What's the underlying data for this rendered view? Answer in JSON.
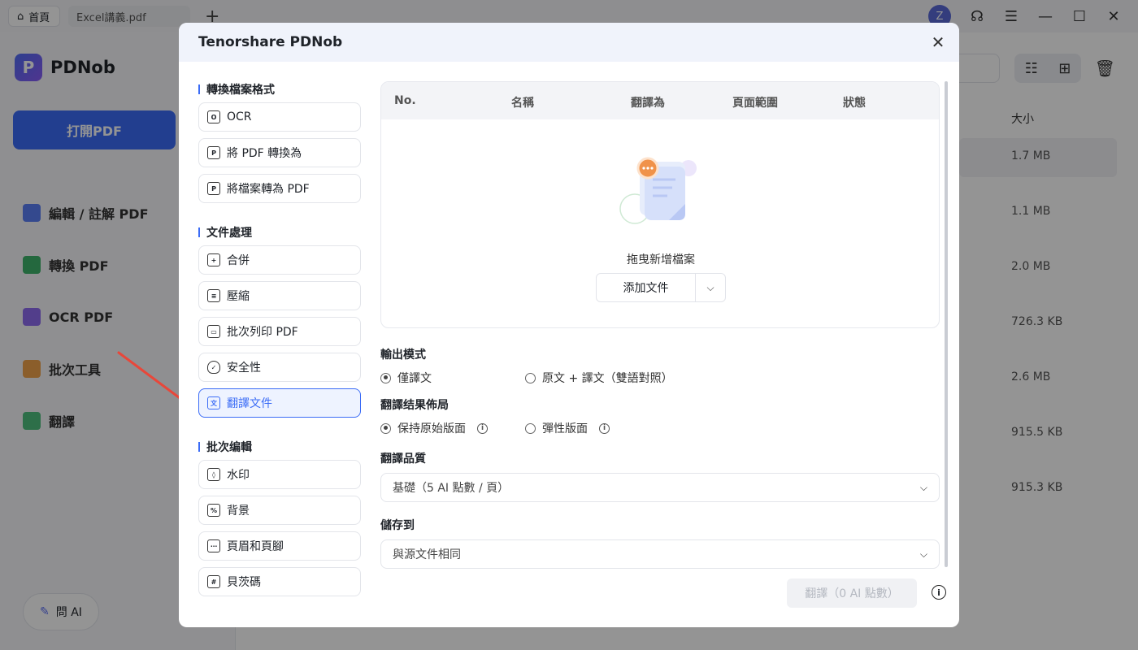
{
  "topbar": {
    "home_tab": "首頁",
    "file_tab": "Excel講義.pdf",
    "avatar_letter": "Z"
  },
  "sidebar": {
    "brand": "PDNob",
    "open_pdf": "打開PDF",
    "items": [
      {
        "label": "編輯 / 註解 PDF"
      },
      {
        "label": "轉換 PDF"
      },
      {
        "label": "OCR PDF"
      },
      {
        "label": "批次工具"
      },
      {
        "label": "翻譯"
      }
    ],
    "ask_ai": "問 AI"
  },
  "file_list": {
    "size_header": "大小",
    "sizes": [
      "1.7 MB",
      "1.1 MB",
      "2.0 MB",
      "726.3 KB",
      "2.6 MB",
      "915.5 KB",
      "915.3 KB"
    ]
  },
  "dialog": {
    "title": "Tenorshare PDNob",
    "sections": [
      {
        "title": "轉換檔案格式",
        "tools": [
          {
            "label": "OCR"
          },
          {
            "label": "將 PDF 轉換為"
          },
          {
            "label": "將檔案轉為 PDF"
          }
        ]
      },
      {
        "title": "文件處理",
        "tools": [
          {
            "label": "合併"
          },
          {
            "label": "壓縮"
          },
          {
            "label": "批次列印 PDF"
          },
          {
            "label": "安全性"
          },
          {
            "label": "翻譯文件"
          }
        ]
      },
      {
        "title": "批次编輯",
        "tools": [
          {
            "label": "水印"
          },
          {
            "label": "背景"
          },
          {
            "label": "頁眉和頁腳"
          },
          {
            "label": "貝茨碼"
          }
        ]
      }
    ],
    "table": {
      "columns": [
        "No.",
        "名稱",
        "翻譯為",
        "頁面範圍",
        "狀態"
      ],
      "empty_text": "拖曳新增檔案",
      "add_file": "添加文件"
    },
    "output_mode": {
      "label": "輸出模式",
      "options": [
        "僅譯文",
        "原文 + 譯文（雙語對照）"
      ],
      "selected": 0
    },
    "layout": {
      "label": "翻譯结果佈局",
      "options": [
        "保持原始版面",
        "彈性版面"
      ],
      "selected": 0
    },
    "quality": {
      "label": "翻譯品質",
      "value": "基礎（5 AI 點數 / 頁）"
    },
    "save_to": {
      "label": "儲存到",
      "value": "與源文件相同"
    },
    "translate_button": "翻譯（0 AI 點數）",
    "colors": {
      "accent": "#3b6cf6",
      "active_bg": "#eef3ff",
      "arrow": "#e8473a"
    }
  }
}
